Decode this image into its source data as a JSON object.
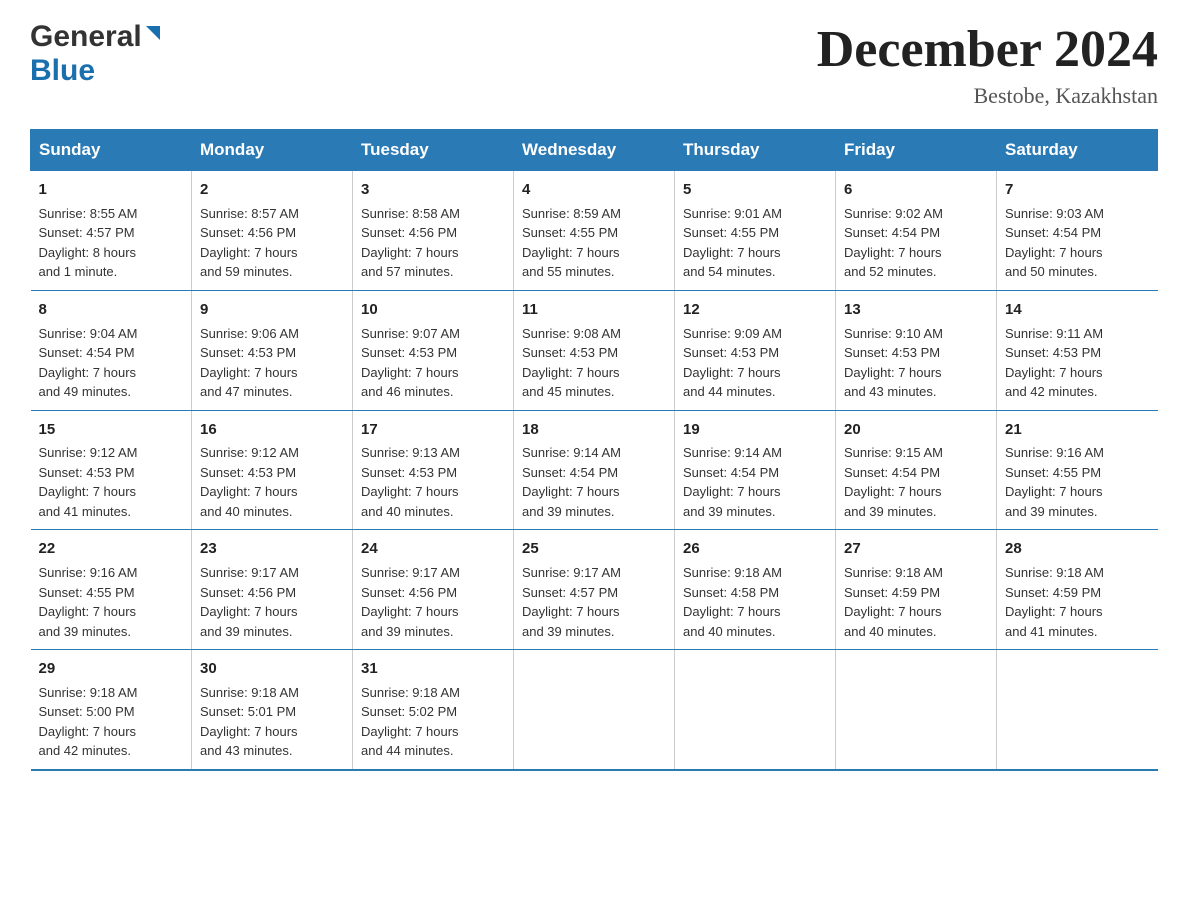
{
  "header": {
    "logo_general": "General",
    "logo_blue": "Blue",
    "title": "December 2024",
    "subtitle": "Bestobe, Kazakhstan"
  },
  "days_of_week": [
    "Sunday",
    "Monday",
    "Tuesday",
    "Wednesday",
    "Thursday",
    "Friday",
    "Saturday"
  ],
  "weeks": [
    [
      {
        "day": "1",
        "info": "Sunrise: 8:55 AM\nSunset: 4:57 PM\nDaylight: 8 hours\nand 1 minute."
      },
      {
        "day": "2",
        "info": "Sunrise: 8:57 AM\nSunset: 4:56 PM\nDaylight: 7 hours\nand 59 minutes."
      },
      {
        "day": "3",
        "info": "Sunrise: 8:58 AM\nSunset: 4:56 PM\nDaylight: 7 hours\nand 57 minutes."
      },
      {
        "day": "4",
        "info": "Sunrise: 8:59 AM\nSunset: 4:55 PM\nDaylight: 7 hours\nand 55 minutes."
      },
      {
        "day": "5",
        "info": "Sunrise: 9:01 AM\nSunset: 4:55 PM\nDaylight: 7 hours\nand 54 minutes."
      },
      {
        "day": "6",
        "info": "Sunrise: 9:02 AM\nSunset: 4:54 PM\nDaylight: 7 hours\nand 52 minutes."
      },
      {
        "day": "7",
        "info": "Sunrise: 9:03 AM\nSunset: 4:54 PM\nDaylight: 7 hours\nand 50 minutes."
      }
    ],
    [
      {
        "day": "8",
        "info": "Sunrise: 9:04 AM\nSunset: 4:54 PM\nDaylight: 7 hours\nand 49 minutes."
      },
      {
        "day": "9",
        "info": "Sunrise: 9:06 AM\nSunset: 4:53 PM\nDaylight: 7 hours\nand 47 minutes."
      },
      {
        "day": "10",
        "info": "Sunrise: 9:07 AM\nSunset: 4:53 PM\nDaylight: 7 hours\nand 46 minutes."
      },
      {
        "day": "11",
        "info": "Sunrise: 9:08 AM\nSunset: 4:53 PM\nDaylight: 7 hours\nand 45 minutes."
      },
      {
        "day": "12",
        "info": "Sunrise: 9:09 AM\nSunset: 4:53 PM\nDaylight: 7 hours\nand 44 minutes."
      },
      {
        "day": "13",
        "info": "Sunrise: 9:10 AM\nSunset: 4:53 PM\nDaylight: 7 hours\nand 43 minutes."
      },
      {
        "day": "14",
        "info": "Sunrise: 9:11 AM\nSunset: 4:53 PM\nDaylight: 7 hours\nand 42 minutes."
      }
    ],
    [
      {
        "day": "15",
        "info": "Sunrise: 9:12 AM\nSunset: 4:53 PM\nDaylight: 7 hours\nand 41 minutes."
      },
      {
        "day": "16",
        "info": "Sunrise: 9:12 AM\nSunset: 4:53 PM\nDaylight: 7 hours\nand 40 minutes."
      },
      {
        "day": "17",
        "info": "Sunrise: 9:13 AM\nSunset: 4:53 PM\nDaylight: 7 hours\nand 40 minutes."
      },
      {
        "day": "18",
        "info": "Sunrise: 9:14 AM\nSunset: 4:54 PM\nDaylight: 7 hours\nand 39 minutes."
      },
      {
        "day": "19",
        "info": "Sunrise: 9:14 AM\nSunset: 4:54 PM\nDaylight: 7 hours\nand 39 minutes."
      },
      {
        "day": "20",
        "info": "Sunrise: 9:15 AM\nSunset: 4:54 PM\nDaylight: 7 hours\nand 39 minutes."
      },
      {
        "day": "21",
        "info": "Sunrise: 9:16 AM\nSunset: 4:55 PM\nDaylight: 7 hours\nand 39 minutes."
      }
    ],
    [
      {
        "day": "22",
        "info": "Sunrise: 9:16 AM\nSunset: 4:55 PM\nDaylight: 7 hours\nand 39 minutes."
      },
      {
        "day": "23",
        "info": "Sunrise: 9:17 AM\nSunset: 4:56 PM\nDaylight: 7 hours\nand 39 minutes."
      },
      {
        "day": "24",
        "info": "Sunrise: 9:17 AM\nSunset: 4:56 PM\nDaylight: 7 hours\nand 39 minutes."
      },
      {
        "day": "25",
        "info": "Sunrise: 9:17 AM\nSunset: 4:57 PM\nDaylight: 7 hours\nand 39 minutes."
      },
      {
        "day": "26",
        "info": "Sunrise: 9:18 AM\nSunset: 4:58 PM\nDaylight: 7 hours\nand 40 minutes."
      },
      {
        "day": "27",
        "info": "Sunrise: 9:18 AM\nSunset: 4:59 PM\nDaylight: 7 hours\nand 40 minutes."
      },
      {
        "day": "28",
        "info": "Sunrise: 9:18 AM\nSunset: 4:59 PM\nDaylight: 7 hours\nand 41 minutes."
      }
    ],
    [
      {
        "day": "29",
        "info": "Sunrise: 9:18 AM\nSunset: 5:00 PM\nDaylight: 7 hours\nand 42 minutes."
      },
      {
        "day": "30",
        "info": "Sunrise: 9:18 AM\nSunset: 5:01 PM\nDaylight: 7 hours\nand 43 minutes."
      },
      {
        "day": "31",
        "info": "Sunrise: 9:18 AM\nSunset: 5:02 PM\nDaylight: 7 hours\nand 44 minutes."
      },
      {
        "day": "",
        "info": ""
      },
      {
        "day": "",
        "info": ""
      },
      {
        "day": "",
        "info": ""
      },
      {
        "day": "",
        "info": ""
      }
    ]
  ]
}
